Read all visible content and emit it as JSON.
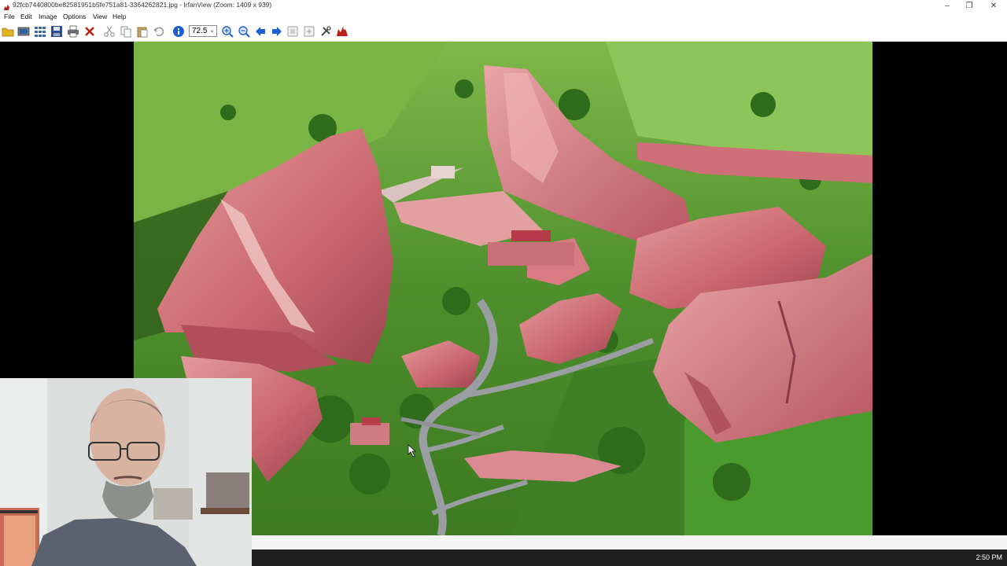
{
  "window": {
    "title": "92fcb7440800be82581951b5fe751a81-3364262821.jpg - IrfanView (Zoom: 1409 x 939)",
    "minimize_symbol": "–",
    "maximize_symbol": "❐",
    "close_symbol": "✕"
  },
  "menu": {
    "items": [
      "File",
      "Edit",
      "Image",
      "Options",
      "View",
      "Help"
    ]
  },
  "toolbar": {
    "zoom_value": "72.5",
    "icons": [
      "open-folder-icon",
      "slideshow-icon",
      "thumbnails-icon",
      "save-icon",
      "print-icon",
      "delete-icon",
      "cut-icon",
      "copy-icon",
      "paste-icon",
      "undo-icon",
      "info-icon",
      "zoom-in-icon",
      "zoom-out-icon",
      "previous-icon",
      "next-icon",
      "fit-icon",
      "actual-size-icon",
      "settings-icon",
      "irfanview-logo-icon"
    ],
    "colors": {
      "accent_blue": "#1e5fd1",
      "delete_red": "#c0201a",
      "folder_yellow": "#e2b325"
    }
  },
  "viewer": {
    "background": "#000000",
    "image_subject": "aerial-photo-red-rock-amphitheatre"
  },
  "taskbar": {
    "clock": "2:50 PM"
  }
}
